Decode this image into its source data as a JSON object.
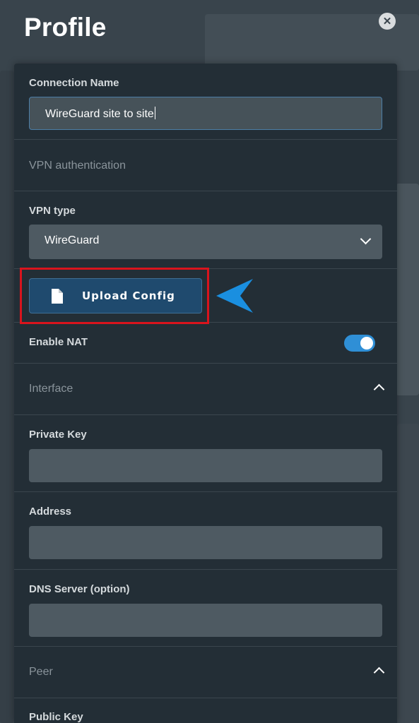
{
  "header": {
    "title": "Profile",
    "close_symbol": "✕"
  },
  "form": {
    "connection_name": {
      "label": "Connection Name",
      "value": "WireGuard site to site"
    },
    "vpn_authentication_heading": "VPN authentication",
    "vpn_type": {
      "label": "VPN type",
      "selected": "WireGuard"
    },
    "upload_config_label": "Upload Config",
    "enable_nat": {
      "label": "Enable NAT",
      "enabled": true
    },
    "interface_section": {
      "heading": "Interface",
      "expanded": true
    },
    "private_key": {
      "label": "Private Key",
      "value": ""
    },
    "address": {
      "label": "Address",
      "value": ""
    },
    "dns_server": {
      "label": "DNS Server (option)",
      "value": ""
    },
    "peer_section": {
      "heading": "Peer",
      "expanded": true
    },
    "public_key": {
      "label": "Public Key"
    }
  },
  "icons": {
    "close": "close-icon",
    "file": "file-icon",
    "chevron_down": "chevron-down-icon",
    "chevron_up": "chevron-up-icon",
    "arrow": "arrow-pointer-icon"
  },
  "colors": {
    "panel": "#232e36",
    "accent": "#2f8fd6",
    "highlight": "#d9141d",
    "arrow": "#1a8fe0"
  }
}
